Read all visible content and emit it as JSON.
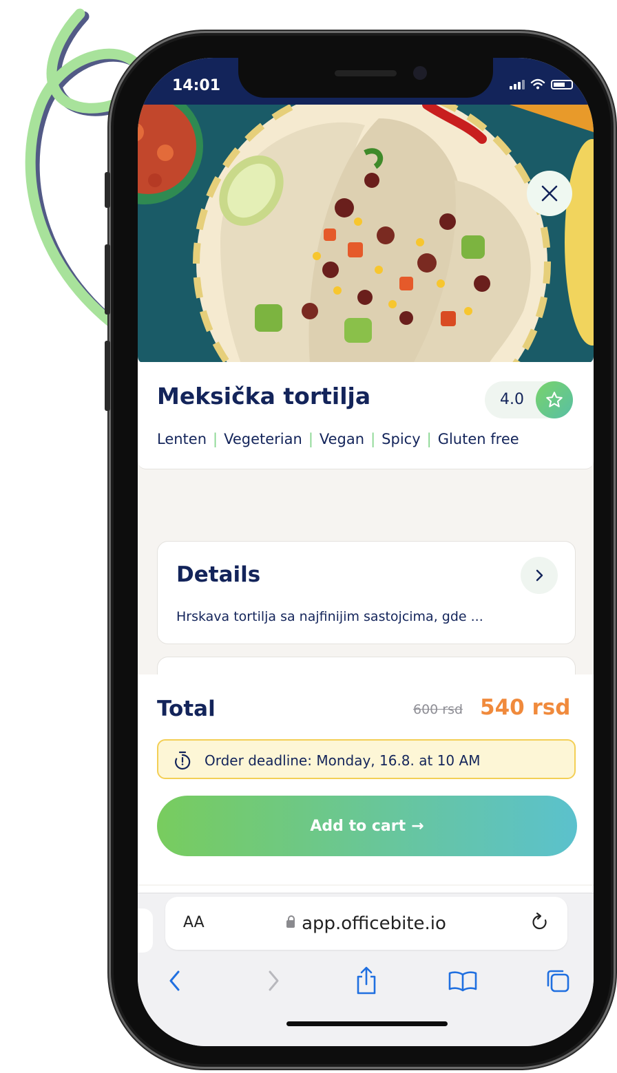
{
  "status_bar": {
    "time": "14:01"
  },
  "hero": {
    "image_icon": "taco-tortilla-photo",
    "close_icon": "close-icon"
  },
  "product": {
    "title": "Meksička tortilja",
    "rating": "4.0",
    "tags": [
      "Lenten",
      "Vegeterian",
      "Vegan",
      "Spicy",
      "Gluten free"
    ]
  },
  "details": {
    "title": "Details",
    "description": "Hrskava tortilja sa najfinijim sastojcima, gde ..."
  },
  "sheet": {
    "total_label": "Total",
    "old_price": "600 rsd",
    "new_price": "540 rsd",
    "deadline": "Order deadline: Monday,  16.8. at 10 AM",
    "add_to_cart": "Add to cart",
    "add_to_cart_arrow": "→"
  },
  "browser": {
    "text_size": "AA",
    "url": "app.officebite.io"
  },
  "colors": {
    "navy": "#13245a",
    "orange": "#f08a3c",
    "green": "#78cc5e",
    "teal": "#5bc1cd",
    "deadline_bg": "#fdf6d6",
    "deadline_border": "#f3cf55"
  }
}
